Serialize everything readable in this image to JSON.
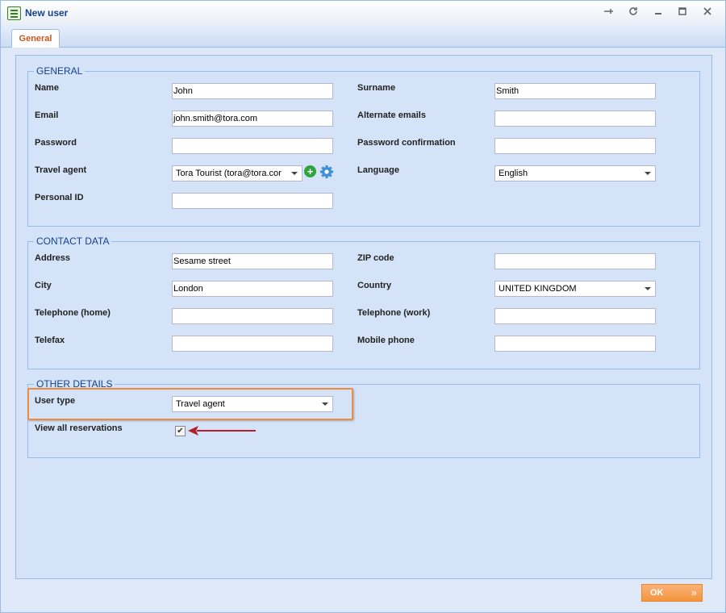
{
  "window": {
    "title": "New user"
  },
  "tabs": [
    {
      "label": "General"
    }
  ],
  "general": {
    "legend": "GENERAL",
    "name_label": "Name",
    "name_value": "John",
    "surname_label": "Surname",
    "surname_value": "Smith",
    "email_label": "Email",
    "email_value": "john.smith@tora.com",
    "alternate_emails_label": "Alternate emails",
    "alternate_emails_value": "",
    "password_label": "Password",
    "password_value": "",
    "password_confirmation_label": "Password confirmation",
    "password_confirmation_value": "",
    "travel_agent_label": "Travel agent",
    "travel_agent_value": "Tora Tourist (tora@tora.cor",
    "language_label": "Language",
    "language_value": "English",
    "personal_id_label": "Personal ID",
    "personal_id_value": ""
  },
  "contact": {
    "legend": "CONTACT DATA",
    "address_label": "Address",
    "address_value": "Sesame street",
    "zip_label": "ZIP code",
    "zip_value": "",
    "city_label": "City",
    "city_value": "London",
    "country_label": "Country",
    "country_value": "UNITED KINGDOM",
    "tel_home_label": "Telephone (home)",
    "tel_home_value": "",
    "tel_work_label": "Telephone (work)",
    "tel_work_value": "",
    "telefax_label": "Telefax",
    "telefax_value": "",
    "mobile_label": "Mobile phone",
    "mobile_value": ""
  },
  "other": {
    "legend": "OTHER DETAILS",
    "user_type_label": "User type",
    "user_type_value": "Travel agent",
    "view_all_label": "View all reservations",
    "view_all_checked": true
  },
  "footer": {
    "ok_label": "OK"
  },
  "colors": {
    "accent": "#f08a3c",
    "header_text": "#15428b",
    "arrow": "#b3202a"
  }
}
